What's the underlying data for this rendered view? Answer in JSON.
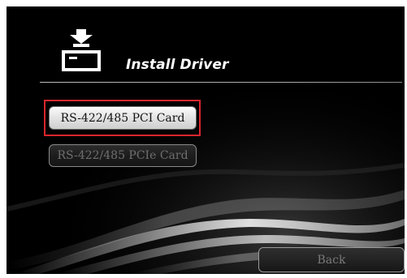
{
  "header": {
    "title": "Install Driver",
    "icon": "download-card-icon"
  },
  "buttons": {
    "pci_label": "RS-422/485 PCI Card",
    "pcie_label": "RS-422/485 PCIe Card",
    "back_label": "Back"
  },
  "state": {
    "selected": "RS-422/485 PCI Card",
    "pcie_enabled": false,
    "back_enabled": false
  },
  "colors": {
    "background": "#000000",
    "highlight_border": "#d9262c",
    "title": "#ffffff"
  }
}
